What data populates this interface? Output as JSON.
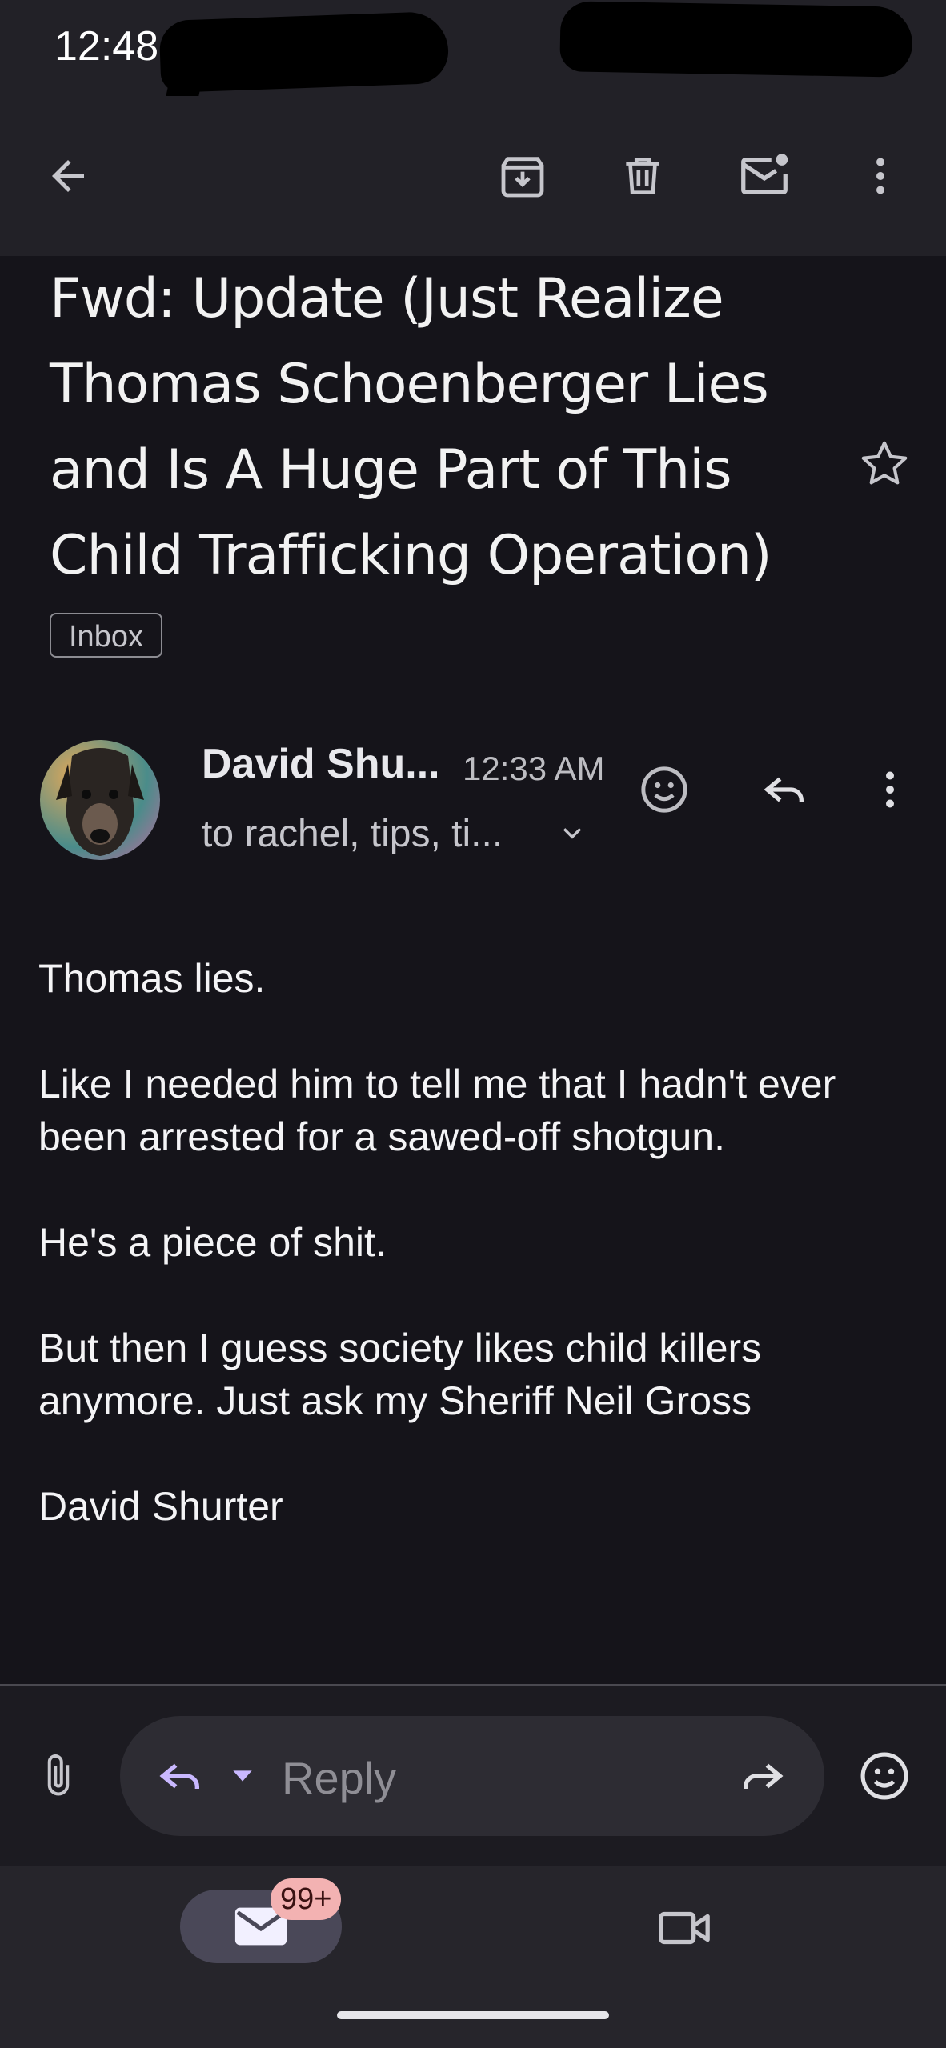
{
  "status_bar": {
    "time": "12:48"
  },
  "toolbar": {
    "icons": [
      "back-arrow-icon",
      "archive-icon",
      "trash-icon",
      "mark-unread-icon",
      "more-vert-icon"
    ]
  },
  "email": {
    "subject": "Fwd: Update (Just Realize Thomas Schoenberger Lies and Is A Huge Part of This Child Trafficking Operation)",
    "label": "Inbox",
    "sender": "David Shu...",
    "time": "12:33 AM",
    "recipients": "to rachel, tips, ti...",
    "body": [
      "Thomas lies.",
      "Like I needed him to tell me that I hadn't ever been arrested for a sawed-off shotgun.",
      "He's a piece of shit.",
      "But then I guess society likes child killers anymore. Just ask my Sheriff Neil Gross",
      "David Shurter"
    ]
  },
  "reply_bar": {
    "placeholder": "Reply"
  },
  "bottom_nav": {
    "mail_badge": "99+"
  },
  "colors": {
    "background": "#15141a",
    "bar": "#222127",
    "accent": "#c9b8ff",
    "badge": "#f3b2b2"
  }
}
